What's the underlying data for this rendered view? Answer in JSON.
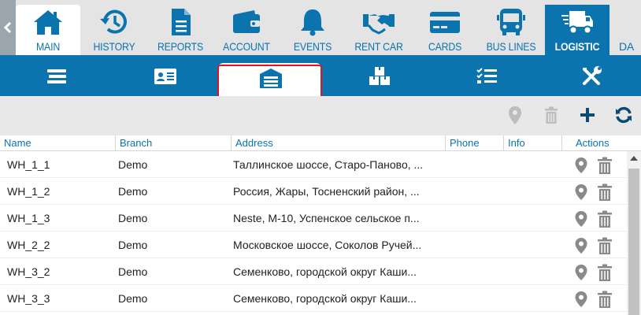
{
  "top_nav": {
    "items": [
      {
        "label": "MAIN",
        "icon": "home-icon"
      },
      {
        "label": "HISTORY",
        "icon": "history-icon"
      },
      {
        "label": "REPORTS",
        "icon": "document-icon"
      },
      {
        "label": "ACCOUNT",
        "icon": "wallet-icon"
      },
      {
        "label": "EVENTS",
        "icon": "bell-icon"
      },
      {
        "label": "RENT CAR",
        "icon": "handshake-icon"
      },
      {
        "label": "CARDS",
        "icon": "credit-card-icon"
      },
      {
        "label": "BUS LINES",
        "icon": "bus-icon"
      },
      {
        "label": "LOGISTIC",
        "icon": "truck-icon"
      },
      {
        "label": "DA",
        "icon": ""
      }
    ],
    "active": "LOGISTIC"
  },
  "sub_nav": {
    "tabs": [
      "bars-icon",
      "id-card-icon",
      "warehouse-icon",
      "boxes-icon",
      "tasks-icon",
      "tools-icon"
    ],
    "active_index": 2
  },
  "toolbar": {
    "buttons": [
      "map-marker-icon",
      "trash-icon",
      "plus-icon",
      "refresh-icon"
    ]
  },
  "grid": {
    "columns": [
      "Name",
      "Branch",
      "Address",
      "Phone",
      "Info",
      "Actions"
    ],
    "rows": [
      {
        "name": "WH_1_1",
        "branch": "Demo",
        "address": "Таллинское шоссе, Старо-Паново, ...",
        "phone": "",
        "info": ""
      },
      {
        "name": "WH_1_2",
        "branch": "Demo",
        "address": "Россия, Жары, Тосненский район, ...",
        "phone": "",
        "info": ""
      },
      {
        "name": "WH_1_3",
        "branch": "Demo",
        "address": "Neste, М-10, Успенское сельское п...",
        "phone": "",
        "info": ""
      },
      {
        "name": "WH_2_2",
        "branch": "Demo",
        "address": "Московское шоссе, Соколов Ручей...",
        "phone": "",
        "info": ""
      },
      {
        "name": "WH_3_2",
        "branch": "Demo",
        "address": "Семенково, городской округ Каши...",
        "phone": "",
        "info": ""
      },
      {
        "name": "WH_3_3",
        "branch": "Demo",
        "address": "Семенково, городской округ Каши...",
        "phone": "",
        "info": ""
      }
    ]
  },
  "colors": {
    "primary": "#0b73ad",
    "highlight": "#e3141b",
    "disabled": "#bdbdbd",
    "action_icon": "#8a8a8a"
  }
}
